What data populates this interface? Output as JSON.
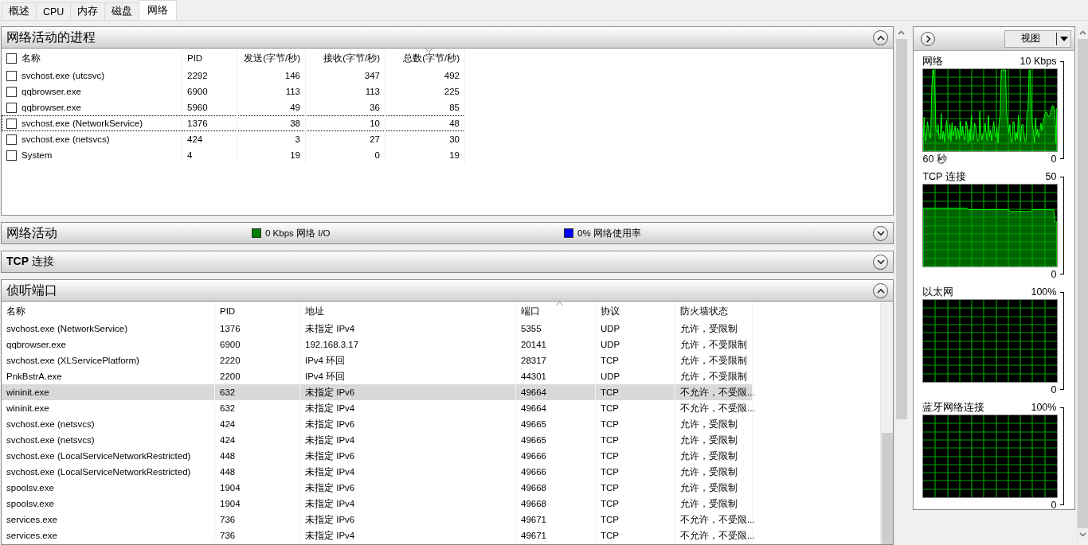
{
  "tabs": [
    {
      "label": "概述",
      "selected": false
    },
    {
      "label": "CPU",
      "selected": false
    },
    {
      "label": "内存",
      "selected": false
    },
    {
      "label": "磁盘",
      "selected": false
    },
    {
      "label": "网络",
      "selected": true
    }
  ],
  "process_panel": {
    "title": "网络活动的进程",
    "expanded": true,
    "select_all_checked": false,
    "columns": [
      {
        "label": "名称",
        "sorted": false
      },
      {
        "label": "PID",
        "sorted": false
      },
      {
        "label": "发送(字节/秒)",
        "sorted": false
      },
      {
        "label": "接收(字节/秒)",
        "sorted": false
      },
      {
        "label": "总数(字节/秒)",
        "sorted": true,
        "descending": true
      }
    ],
    "rows": [
      {
        "checked": false,
        "focused": false,
        "cells": [
          "svchost.exe (utcsvc)",
          "2292",
          "146",
          "347",
          "492"
        ]
      },
      {
        "checked": false,
        "focused": false,
        "cells": [
          "qqbrowser.exe",
          "6900",
          "113",
          "113",
          "225"
        ]
      },
      {
        "checked": false,
        "focused": false,
        "cells": [
          "qqbrowser.exe",
          "5960",
          "49",
          "36",
          "85"
        ]
      },
      {
        "checked": false,
        "focused": true,
        "cells": [
          "svchost.exe (NetworkService)",
          "1376",
          "38",
          "10",
          "48"
        ]
      },
      {
        "checked": false,
        "focused": false,
        "cells": [
          "svchost.exe (netsvcs)",
          "424",
          "3",
          "27",
          "30"
        ]
      },
      {
        "checked": false,
        "focused": false,
        "cells": [
          "System",
          "4",
          "19",
          "0",
          "19"
        ]
      }
    ]
  },
  "activity_panel": {
    "title": "网络活动",
    "expanded": false,
    "legend": [
      {
        "label": "0 Kbps 网络 I/O",
        "color": "#008000"
      },
      {
        "label": "0% 网络使用率",
        "color": "#0000ff"
      }
    ]
  },
  "tcp_panel": {
    "title_bold": "TCP",
    "title": "连接",
    "expanded": false
  },
  "ports_panel": {
    "title": "侦听端口",
    "expanded": true,
    "columns": [
      {
        "label": "名称",
        "sorted": false
      },
      {
        "label": "PID",
        "sorted": false
      },
      {
        "label": "地址",
        "sorted": false
      },
      {
        "label": "端口",
        "sorted": true,
        "descending": false
      },
      {
        "label": "协议",
        "sorted": false
      },
      {
        "label": "防火墙状态",
        "sorted": false
      }
    ],
    "rows": [
      {
        "selected": false,
        "cells": [
          "svchost.exe (NetworkService)",
          "1376",
          "未指定 IPv4",
          "5355",
          "UDP",
          "允许，受限制"
        ]
      },
      {
        "selected": false,
        "cells": [
          "qqbrowser.exe",
          "6900",
          "192.168.3.17",
          "20141",
          "UDP",
          "允许，不受限制"
        ]
      },
      {
        "selected": false,
        "cells": [
          "svchost.exe (XLServicePlatform)",
          "2220",
          "IPv4 环回",
          "28317",
          "TCP",
          "允许，不受限制"
        ]
      },
      {
        "selected": false,
        "cells": [
          "PnkBstrA.exe",
          "2200",
          "IPv4 环回",
          "44301",
          "UDP",
          "允许，不受限制"
        ]
      },
      {
        "selected": true,
        "cells": [
          "wininit.exe",
          "632",
          "未指定 IPv6",
          "49664",
          "TCP",
          "不允许，不受限..."
        ]
      },
      {
        "selected": false,
        "cells": [
          "wininit.exe",
          "632",
          "未指定 IPv4",
          "49664",
          "TCP",
          "不允许，不受限..."
        ]
      },
      {
        "selected": false,
        "cells": [
          "svchost.exe (netsvcs)",
          "424",
          "未指定 IPv6",
          "49665",
          "TCP",
          "允许，受限制"
        ]
      },
      {
        "selected": false,
        "cells": [
          "svchost.exe (netsvcs)",
          "424",
          "未指定 IPv4",
          "49665",
          "TCP",
          "允许，受限制"
        ]
      },
      {
        "selected": false,
        "cells": [
          "svchost.exe (LocalServiceNetworkRestricted)",
          "448",
          "未指定 IPv6",
          "49666",
          "TCP",
          "允许，受限制"
        ]
      },
      {
        "selected": false,
        "cells": [
          "svchost.exe (LocalServiceNetworkRestricted)",
          "448",
          "未指定 IPv4",
          "49666",
          "TCP",
          "允许，受限制"
        ]
      },
      {
        "selected": false,
        "cells": [
          "spoolsv.exe",
          "1904",
          "未指定 IPv6",
          "49668",
          "TCP",
          "允许，受限制"
        ]
      },
      {
        "selected": false,
        "cells": [
          "spoolsv.exe",
          "1904",
          "未指定 IPv4",
          "49668",
          "TCP",
          "允许，受限制"
        ]
      },
      {
        "selected": false,
        "cells": [
          "services.exe",
          "736",
          "未指定 IPv6",
          "49671",
          "TCP",
          "不允许，不受限..."
        ]
      },
      {
        "selected": false,
        "cells": [
          "services.exe",
          "736",
          "未指定 IPv4",
          "49671",
          "TCP",
          "不允许，不受限..."
        ]
      }
    ]
  },
  "graph_panel": {
    "view_button": "视图",
    "graphs": [
      {
        "title": "网络",
        "max": "10 Kbps",
        "min": "0",
        "time": "60 秒",
        "kind": "spikes"
      },
      {
        "title": "TCP 连接",
        "max": "50",
        "min": "0",
        "kind": "plateau"
      },
      {
        "title": "以太网",
        "max": "100%",
        "min": "0",
        "kind": "empty"
      },
      {
        "title": "蓝牙网络连接",
        "max": "100%",
        "min": "0",
        "kind": "empty"
      }
    ]
  }
}
